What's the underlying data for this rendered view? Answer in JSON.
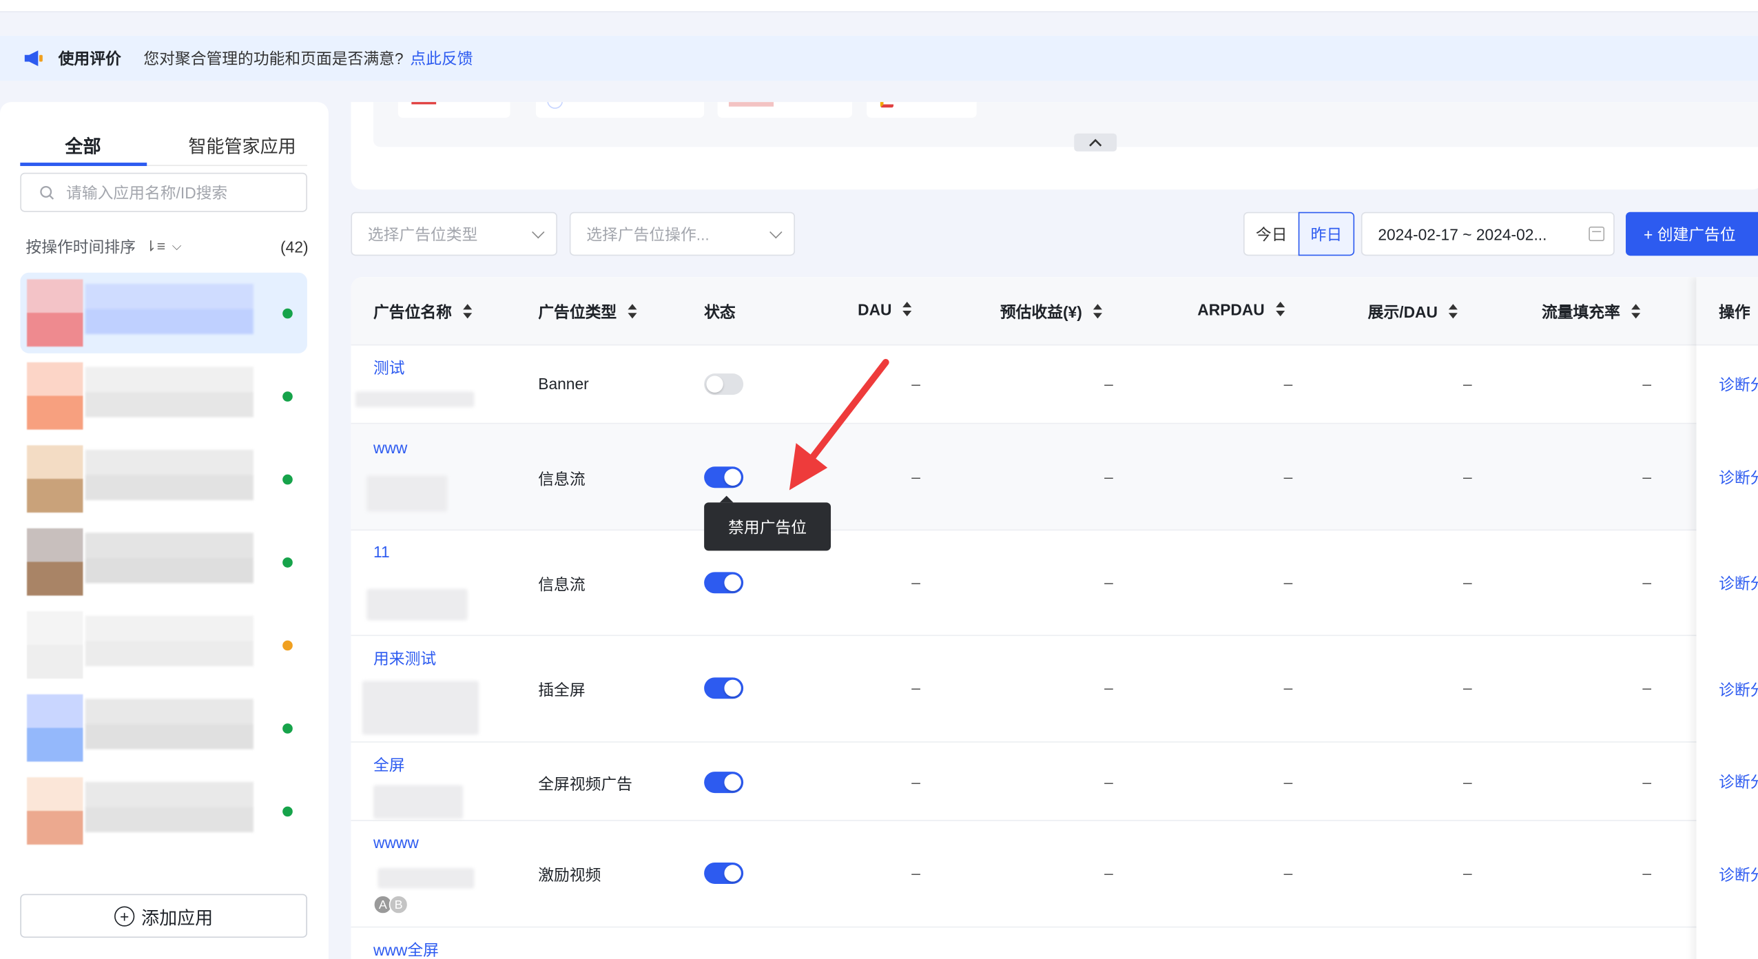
{
  "feedback": {
    "title": "使用评价",
    "question": "您对聚合管理的功能和页面是否满意?",
    "link": "点此反馈"
  },
  "sidebar": {
    "tab_all": "全部",
    "tab_smart": "智能管家应用",
    "search_placeholder": "请输入应用名称/ID搜索",
    "sort_label": "按操作时间排序",
    "count": "(42)",
    "add_app": "添加应用",
    "status_colors": [
      "#16a34a",
      "#16a34a",
      "#16a34a",
      "#16a34a",
      "#f0a020",
      "#16a34a",
      "#16a34a"
    ]
  },
  "filters": {
    "type_placeholder": "选择广告位类型",
    "op_placeholder": "选择广告位操作...",
    "today": "今日",
    "yesterday": "昨日",
    "date_range": "2024-02-17 ~ 2024-02...",
    "create_button": "+ 创建广告位"
  },
  "table": {
    "headers": {
      "name": "广告位名称",
      "type": "广告位类型",
      "status": "状态",
      "dau": "DAU",
      "revenue": "预估收益(¥)",
      "arpdau": "ARPDAU",
      "impressions": "展示/DAU",
      "fill_rate": "流量填充率",
      "action": "操作"
    },
    "rows": [
      {
        "name": "测试",
        "type": "Banner",
        "enabled": false,
        "dau": "–",
        "revenue": "–",
        "arpdau": "–",
        "impressions": "–",
        "fill_rate": "–",
        "action": "诊断分析"
      },
      {
        "name": "www",
        "type": "信息流",
        "enabled": true,
        "dau": "–",
        "revenue": "–",
        "arpdau": "–",
        "impressions": "–",
        "fill_rate": "–",
        "action": "诊断分析"
      },
      {
        "name": "11",
        "type": "信息流",
        "enabled": true,
        "dau": "–",
        "revenue": "–",
        "arpdau": "–",
        "impressions": "–",
        "fill_rate": "–",
        "action": "诊断分析"
      },
      {
        "name": "用来测试",
        "type": "插全屏",
        "enabled": true,
        "dau": "–",
        "revenue": "–",
        "arpdau": "–",
        "impressions": "–",
        "fill_rate": "–",
        "action": "诊断分析"
      },
      {
        "name": "全屏",
        "type": "全屏视频广告",
        "enabled": true,
        "dau": "–",
        "revenue": "–",
        "arpdau": "–",
        "impressions": "–",
        "fill_rate": "–",
        "action": "诊断分析"
      },
      {
        "name": "wwww",
        "type": "激励视频",
        "enabled": true,
        "dau": "–",
        "revenue": "–",
        "arpdau": "–",
        "impressions": "–",
        "fill_rate": "–",
        "action": "诊断分析"
      },
      {
        "name": "www全屏",
        "type": "",
        "enabled": true,
        "dau": "",
        "revenue": "",
        "arpdau": "",
        "impressions": "",
        "fill_rate": "",
        "action": ""
      }
    ],
    "row6_avatars": [
      "A",
      "B"
    ]
  },
  "tooltip": "禁用广告位",
  "colors": {
    "accent": "#2d5bf0",
    "arrow": "#ee3b3b"
  }
}
